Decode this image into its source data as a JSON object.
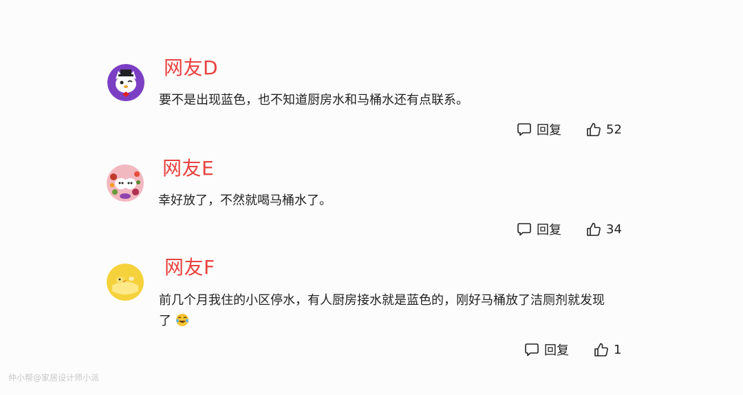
{
  "comments": [
    {
      "username": "网友D",
      "text": "要不是出现蓝色，也不知道厨房水和马桶水还有点联系。",
      "reply_label": "回复",
      "likes": "52",
      "avatar_icon": "cartoon-cat-avatar",
      "avatar_color": "#7b3fc4"
    },
    {
      "username": "网友E",
      "text": "幸好放了，不然就喝马桶水了。",
      "reply_label": "回复",
      "likes": "34",
      "avatar_icon": "flower-dog-avatar",
      "avatar_color": "#f2b8c0"
    },
    {
      "username": "网友F",
      "text": "前几个月我住的小区停水，有人厨房接水就是蓝色的，刚好马桶放了洁厕剂就发现了",
      "reply_label": "回复",
      "likes": "1",
      "avatar_icon": "yellow-duck-avatar",
      "avatar_color": "#f5d23c"
    }
  ],
  "watermark": "仲小帮@家居设计师小派",
  "accent_color": "#e8423f"
}
